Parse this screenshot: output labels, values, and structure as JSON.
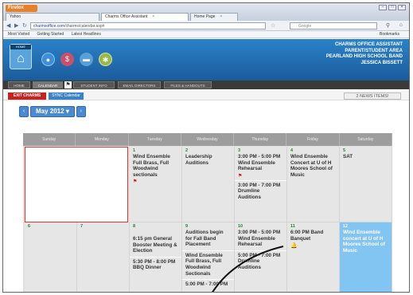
{
  "browser": {
    "menu_label": "Firefox",
    "tabs": [
      {
        "label": "Yahoo",
        "active": false
      },
      {
        "label": "Charms Office Assistant",
        "active": true
      },
      {
        "label": "Home Page",
        "active": false
      }
    ],
    "url_host": "charmsoffice.com",
    "url_rest": "/charms/calendar.asp#",
    "search_placeholder": "Google",
    "bookmarks": [
      "Most Visited",
      "Getting Started",
      "Latest Headlines"
    ],
    "bookmarks_right": "Bookmarks"
  },
  "app": {
    "home_label": "HOME",
    "header_lines": [
      "CHARMS OFFICE ASSISTANT",
      "PARENT/STUDENT AREA",
      "PEARLAND HIGH SCHOOL BAND",
      "JESSICA BISSETT"
    ],
    "menu_tabs": [
      "HOME",
      "CALENDAR",
      "STUDENT INFO",
      "EMAIL DIRECTORS",
      "FILES & HANDOUTS"
    ],
    "exit_label": "EXIT CHARMS",
    "sync_label": "SYNC Calendar",
    "news_label": "2 NEWS ITEMS!"
  },
  "calendar": {
    "month_label": "May 2012",
    "prev_label": "‹",
    "next_label": "›",
    "days_of_week": [
      "Sunday",
      "Monday",
      "Tuesday",
      "Wednesday",
      "Thursday",
      "Friday",
      "Saturday"
    ],
    "week1": {
      "tue": {
        "num": "1",
        "events": [
          "Wind Ensemble Full Brass, Full Woodwind sectionals"
        ]
      },
      "wed": {
        "num": "2",
        "events": [
          "Leadership Auditions"
        ]
      },
      "thu": {
        "num": "3",
        "events": [
          "3:00 PM - 5:00 PM Wind Ensemble Rehearsal",
          "3:00 PM - 7:00 PM Drumline Auditions"
        ]
      },
      "fri": {
        "num": "4",
        "events": [
          "Wind Ensemble Concert at U of H Moores School of Music"
        ]
      },
      "sat": {
        "num": "5",
        "events": [
          "SAT"
        ]
      }
    },
    "week2": {
      "sun": {
        "num": "6"
      },
      "mon": {
        "num": "7"
      },
      "tue": {
        "num": "8",
        "events": [
          "6:15 pm General Booster Meeting & Election",
          "5:30 PM - 8:00 PM BBQ Dinner"
        ]
      },
      "wed": {
        "num": "9",
        "events": [
          "Auditions begin for Fall Band Placement",
          "Wind Ensemble Full Brass, Full Woodwind Sectionals",
          "5:00 PM - 7:00 PM"
        ]
      },
      "thu": {
        "num": "10",
        "events": [
          "3:00 PM - 5:00 PM Wind Ensemble Rehearsal",
          "5:00 PM - 7:00 PM Drumline Auditions"
        ]
      },
      "fri": {
        "num": "11",
        "events": [
          "6:00 PM Band Banquet"
        ]
      },
      "sat": {
        "num": "12",
        "events": [
          "Wind Ensemble concert at U of H Moores School of Music"
        ]
      }
    }
  },
  "colors": {
    "accent": "#2a82c9",
    "highlight_cell": "#82c4f2",
    "exit_red": "#c62323"
  }
}
